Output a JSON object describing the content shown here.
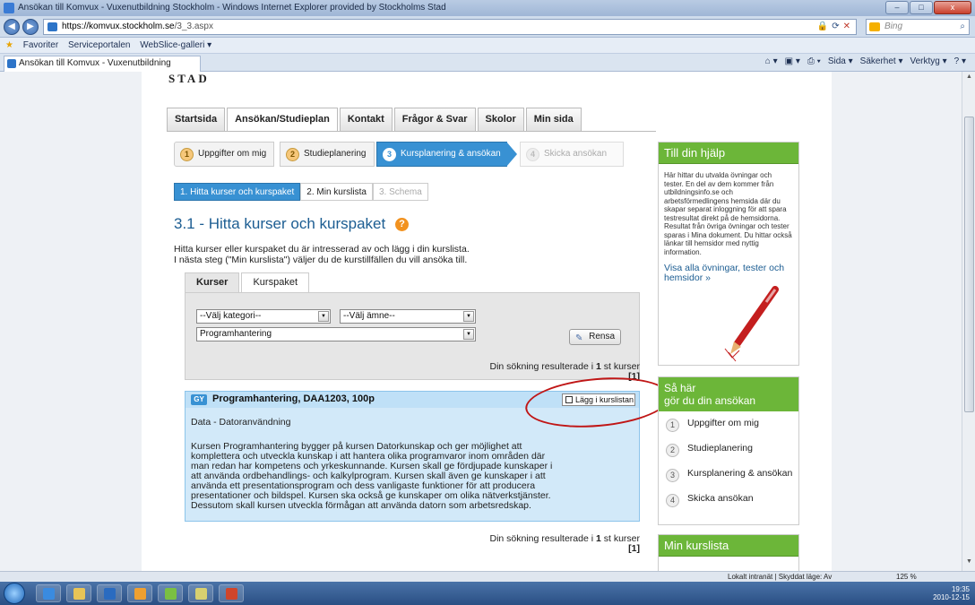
{
  "window": {
    "title": "Ansökan till Komvux - Vuxenutbildning Stockholm - Windows Internet Explorer provided by Stockholms Stad",
    "min": "–",
    "max": "□",
    "close": "x"
  },
  "address": {
    "host": "https://komvux.stockholm.se",
    "path": "/3_3.aspx",
    "search_placeholder": "Bing"
  },
  "favorites": {
    "label": "Favoriter",
    "items": [
      "Serviceportalen",
      "WebSlice-galleri ▾"
    ]
  },
  "browser_tab": "Ansökan till Komvux - Vuxenutbildning Stockholm",
  "command_bar": [
    "Sida ▾",
    "Säkerhet ▾",
    "Verktyg ▾"
  ],
  "logo": "STAD",
  "main_nav": [
    "Startsida",
    "Ansökan/Studieplan",
    "Kontakt",
    "Frågor & Svar",
    "Skolor",
    "Min sida"
  ],
  "wizard": [
    {
      "num": "1",
      "label": "Uppgifter om mig"
    },
    {
      "num": "2",
      "label": "Studieplanering"
    },
    {
      "num": "3",
      "label": "Kursplanering & ansökan"
    },
    {
      "num": "4",
      "label": "Skicka ansökan"
    }
  ],
  "subtabs": [
    "1. Hitta kurser och kurspaket",
    "2. Min kurslista",
    "3. Schema"
  ],
  "section": {
    "title": "3.1 - Hitta kurser och kurspaket",
    "help": "?",
    "intro_1": "Hitta kurser eller kurspaket du är intresserad av och lägg i din kurslista.",
    "intro_2": "I nästa steg (\"Min kurslista\") väljer du de kurstillfällen du vill ansöka till."
  },
  "search": {
    "tabs": [
      "Kurser",
      "Kurspaket"
    ],
    "category": "--Välj kategori--",
    "subject": "--Välj ämne--",
    "course": "Programhantering",
    "clear_button": "Rensa"
  },
  "results": {
    "prefix": "Din sökning resulterade i",
    "count": "1",
    "suffix_top": "st kurser",
    "suffix_bottom": "st kurser",
    "page": "[1]"
  },
  "course": {
    "badge": "GY",
    "title": "Programhantering, DAA1203, 100p",
    "add_button": "Lägg i kurslistan",
    "subject": "Data - Datoranvändning",
    "description": "Kursen Programhantering bygger på kursen Datorkunskap och ger möjlighet att komplettera och utveckla kunskap i att hantera olika programvaror inom områden där man redan har kompetens och yrkeskunnande. Kursen skall ge fördjupade kunskaper i att använda ordbehandlings- och kalkylprogram. Kursen skall även ge kunskaper i att använda ett presentationsprogram och dess vanligaste funktioner för att producera presentationer och bildspel. Kursen ska också ge kunskaper om olika nätverkstjänster. Dessutom skall kursen utveckla förmågan att använda datorn som arbetsredskap."
  },
  "sidebar": {
    "help_title": "Till din hjälp",
    "help_text": "Här hittar du utvalda övningar och tester. En del av dem kommer från utbildningsinfo.se och arbetsförmedlingens hemsida där du skapar separat inloggning för att spara testresultat direkt på de hemsidorna. Resultat från övriga övningar och tester sparas i Mina dokument. Du hittar också länkar till hemsidor med nyttig information.",
    "help_link": "Visa alla övningar, tester och hemsidor »",
    "steps_title_1": "Så här",
    "steps_title_2": "gör du din ansökan",
    "steps": [
      {
        "num": "1",
        "label": "Uppgifter om mig"
      },
      {
        "num": "2",
        "label": "Studieplanering"
      },
      {
        "num": "3",
        "label": "Kursplanering & ansökan"
      },
      {
        "num": "4",
        "label": "Skicka ansökan"
      }
    ],
    "list_title": "Min kurslista"
  },
  "status": {
    "zone": "Lokalt intranät | Skyddat läge: Av",
    "zoom": "125 %"
  },
  "tray": {
    "time": "19:35",
    "date": "2010-12-15"
  },
  "colors": {
    "accent_blue": "#3891d3",
    "green": "#6cb639",
    "card_bg": "#d2e9f9",
    "annotation_red": "#c01616"
  }
}
